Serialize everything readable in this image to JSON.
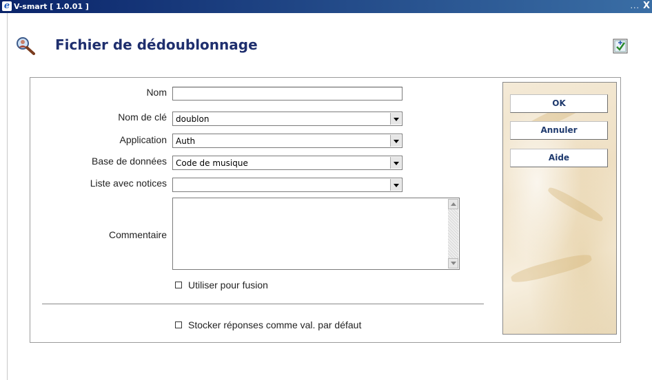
{
  "window": {
    "title": "V-smart [ 1.0.01 ]",
    "dots": "...",
    "close": "X"
  },
  "header": {
    "title": "Fichier de dédoublonnage"
  },
  "form": {
    "nom": {
      "label": "Nom",
      "value": ""
    },
    "nom_cle": {
      "label": "Nom de clé",
      "value": "doublon"
    },
    "application": {
      "label": "Application",
      "value": "Auth"
    },
    "base": {
      "label": "Base de données",
      "value": "Code de musique"
    },
    "liste": {
      "label": "Liste avec notices",
      "value": ""
    },
    "commentaire": {
      "label": "Commentaire",
      "value": ""
    },
    "fusion": {
      "label": "Utiliser pour fusion",
      "checked": false
    },
    "stocker": {
      "label": "Stocker réponses comme val. par défaut",
      "checked": false
    }
  },
  "buttons": {
    "ok": "OK",
    "annuler": "Annuler",
    "aide": "Aide"
  },
  "icons": {
    "app": "ie-icon",
    "header": "search-person-icon",
    "help": "help-cursor-icon"
  }
}
